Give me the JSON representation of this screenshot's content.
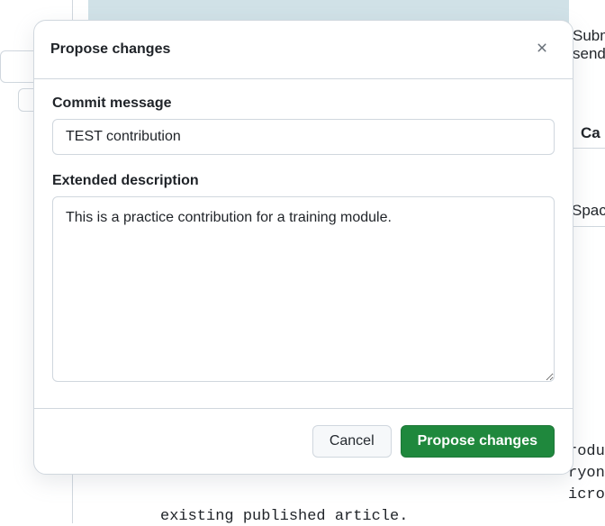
{
  "background": {
    "banner_text1": "Subm",
    "banner_text2": "send",
    "right_label1": "Ca",
    "right_label2": "Spac",
    "body_frag1": "roduc",
    "body_frag2": "ryone",
    "body_frag3": "icros",
    "code_line": "existing published article."
  },
  "modal": {
    "title": "Propose changes",
    "commit_label": "Commit message",
    "commit_value": "TEST contribution",
    "extended_label": "Extended description",
    "extended_value": "This is a practice contribution for a training module.",
    "cancel_label": "Cancel",
    "submit_label": "Propose changes"
  }
}
